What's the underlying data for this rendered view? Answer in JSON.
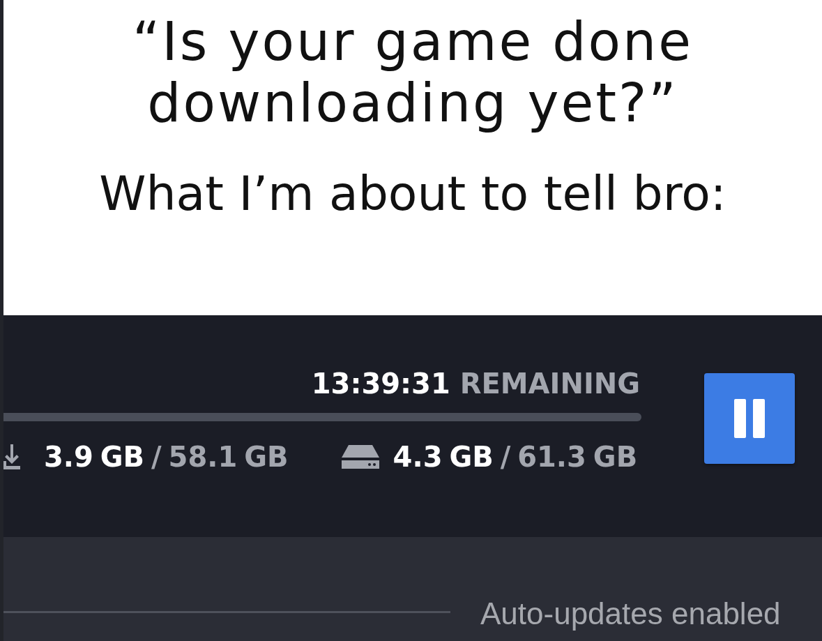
{
  "caption": {
    "question": "“Is your game done downloading yet?”",
    "reply": "What I’m about to tell bro:"
  },
  "download": {
    "remaining": "**13:39:31** REMAINING",
    "downloaded": "**3.9 GB** / 58.1 GB",
    "disk": "**4.3 GB** / 61.3 GB",
    "downloading": true
  },
  "footer": {
    "status": "Auto-updates enabled"
  }
}
